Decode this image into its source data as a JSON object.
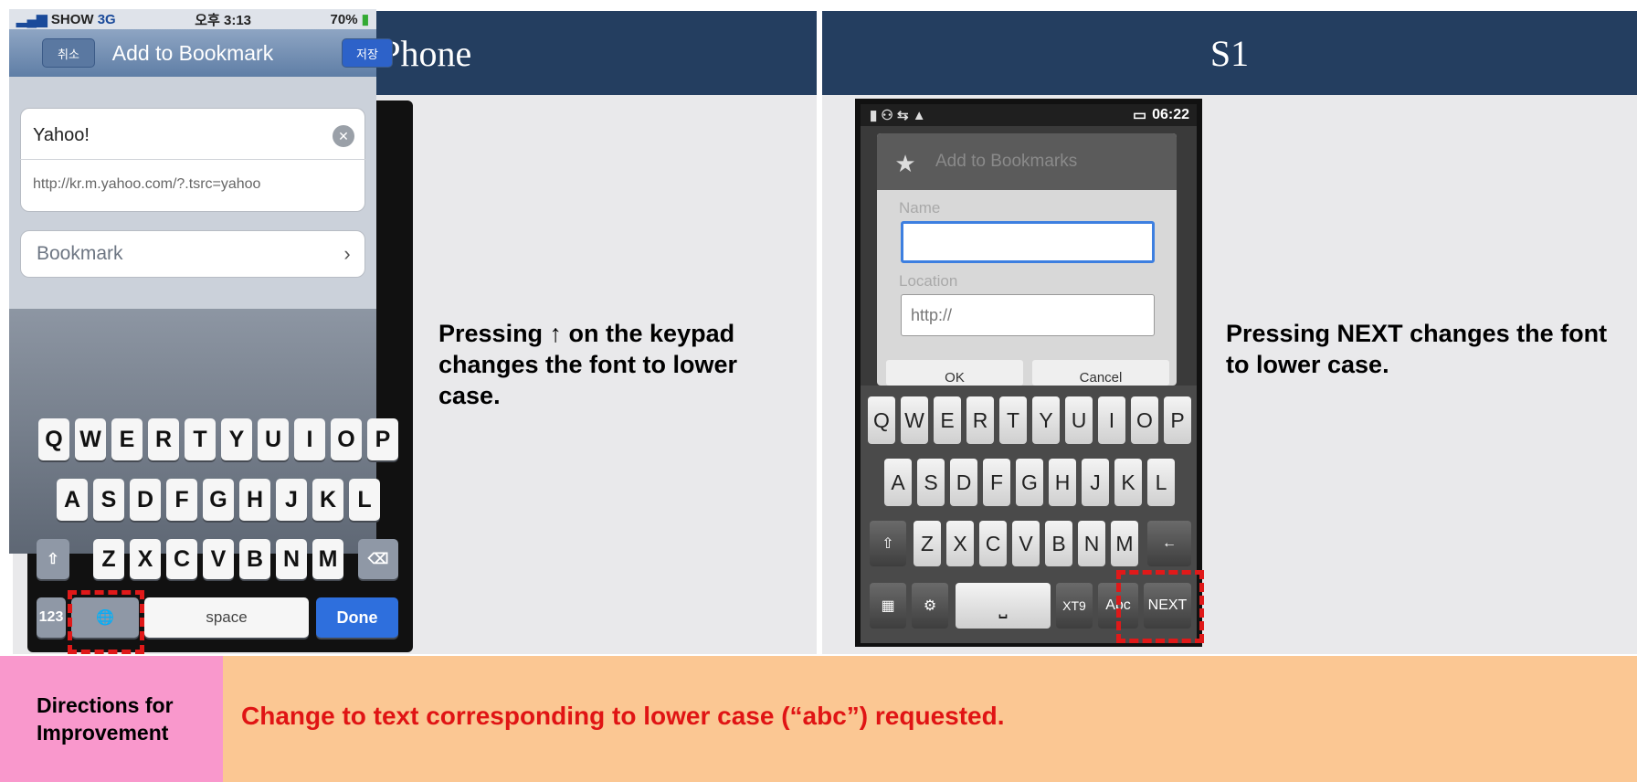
{
  "headers": {
    "left": "i-Phone",
    "right": "S1"
  },
  "iphone": {
    "status": {
      "carrier": "SHOW",
      "network": "3G",
      "time": "오후 3:13",
      "battery": "70%"
    },
    "nav": {
      "cancel": "취소",
      "title": "Add to Bookmark",
      "save": "저장"
    },
    "name_value": "Yahoo!",
    "url_value": "http://kr.m.yahoo.com/?.tsrc=yahoo",
    "bookmark_label": "Bookmark",
    "chevron": "›",
    "clear_glyph": "✕",
    "keys_row1": [
      "Q",
      "W",
      "E",
      "R",
      "T",
      "Y",
      "U",
      "I",
      "O",
      "P"
    ],
    "keys_row2": [
      "A",
      "S",
      "D",
      "F",
      "G",
      "H",
      "J",
      "K",
      "L"
    ],
    "keys_row3": [
      "Z",
      "X",
      "C",
      "V",
      "B",
      "N",
      "M"
    ],
    "shift_glyph": "⇧",
    "backspace_glyph": "⌫",
    "numbers_key": "123",
    "globe_glyph": "🌐",
    "space_key": "space",
    "done_key": "Done"
  },
  "iphone_note": "Pressing ↑ on the keypad changes the font to lower case.",
  "s1": {
    "status_time": "06:22",
    "status_icons": "▮ ⚇ ⇆ ▲",
    "dialog_title": "Add to Bookmarks",
    "name_label": "Name",
    "name_value": "",
    "location_label": "Location",
    "location_value": "http://",
    "ok_button": "OK",
    "cancel_button": "Cancel",
    "keys_row1": [
      "Q",
      "W",
      "E",
      "R",
      "T",
      "Y",
      "U",
      "I",
      "O",
      "P"
    ],
    "keys_row2": [
      "A",
      "S",
      "D",
      "F",
      "G",
      "H",
      "J",
      "K",
      "L"
    ],
    "keys_row3": [
      "Z",
      "X",
      "C",
      "V",
      "B",
      "N",
      "M"
    ],
    "shift_glyph": "⇧",
    "backspace_glyph": "←",
    "keyboard_glyph": "▦",
    "settings_glyph": "⚙",
    "space_glyph": "⎵",
    "xt9_key": "XT9",
    "abc_key": "Abc",
    "next_key": "NEXT"
  },
  "s1_note": "Pressing NEXT changes the font to lower case.",
  "directions_label": "Directions for Improvement",
  "improvement_text": "Change to text corresponding to lower case (“abc”) requested.",
  "colors": {
    "header_bg": "#243e60",
    "panel_bg": "#e9e9eb",
    "directions_bg": "#f998cc",
    "bottom_bg": "#fbc793",
    "improvement_text": "#e01414",
    "highlight": "#e01919"
  }
}
